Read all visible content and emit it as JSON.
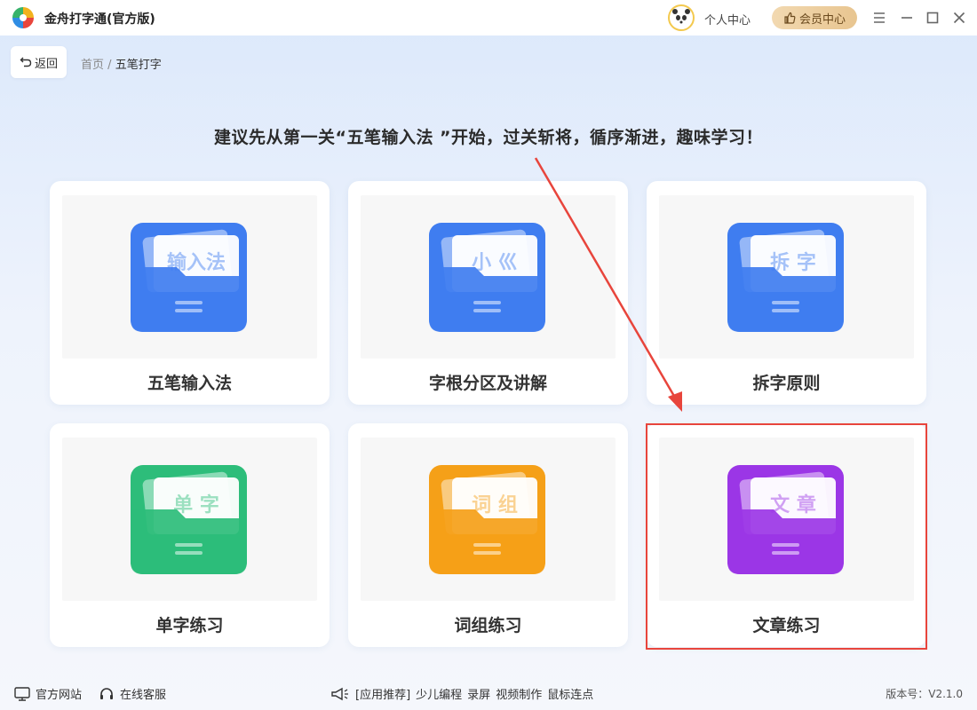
{
  "app": {
    "title": "金舟打字通(官方版)"
  },
  "header": {
    "user_center": "个人中心",
    "vip_center": "会员中心"
  },
  "nav": {
    "back_label": "返回",
    "breadcrumb": [
      "首页",
      "/",
      "五笔打字"
    ]
  },
  "hint": "建议先从第一关“五笔输入法 ”开始，过关斩将，循序渐进，趣味学习！",
  "cards": [
    {
      "label": "五笔输入法",
      "icon_text": "输入法",
      "color": "#3f7df0"
    },
    {
      "label": "字根分区及讲解",
      "icon_text": "小 巛",
      "color": "#3f7df0"
    },
    {
      "label": "拆字原则",
      "icon_text": "拆 字",
      "color": "#3f7df0"
    },
    {
      "label": "单字练习",
      "icon_text": "单 字",
      "color": "#2dbd7a"
    },
    {
      "label": "词组练习",
      "icon_text": "词 组",
      "color": "#f5a018"
    },
    {
      "label": "文章练习",
      "icon_text": "文 章",
      "color": "#9b36e6"
    }
  ],
  "footer": {
    "website": "官方网站",
    "service": "在线客服",
    "recommend": "[应用推荐]",
    "links": [
      "少儿编程",
      "录屏",
      "视频制作",
      "鼠标连点"
    ],
    "version": "版本号：V2.1.0"
  }
}
